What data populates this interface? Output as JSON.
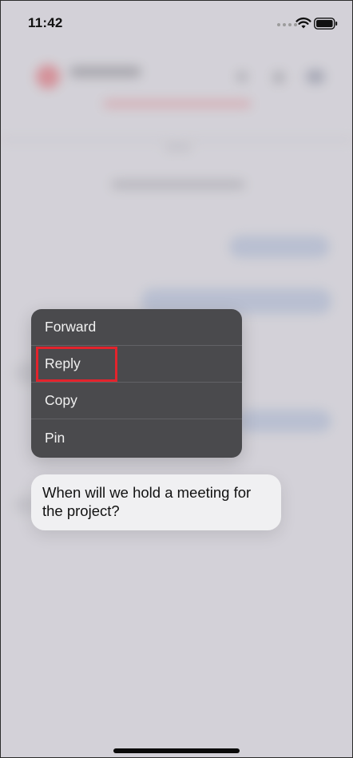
{
  "status_bar": {
    "time": "11:42",
    "wifi_icon": "wifi-icon",
    "battery_icon": "battery-icon",
    "signal_icon": "cellular-dots-icon"
  },
  "context_menu": {
    "items": [
      {
        "label": "Forward"
      },
      {
        "label": "Reply"
      },
      {
        "label": "Copy"
      },
      {
        "label": "Pin"
      }
    ],
    "highlighted_item": "Reply",
    "highlight_color": "#e3232c"
  },
  "message": {
    "text": "When will we hold a meeting for the project?"
  },
  "colors": {
    "menu_background": "#4a4a4d",
    "bubble_background": "#f0f0f2",
    "screen_background": "#d6d5da"
  }
}
